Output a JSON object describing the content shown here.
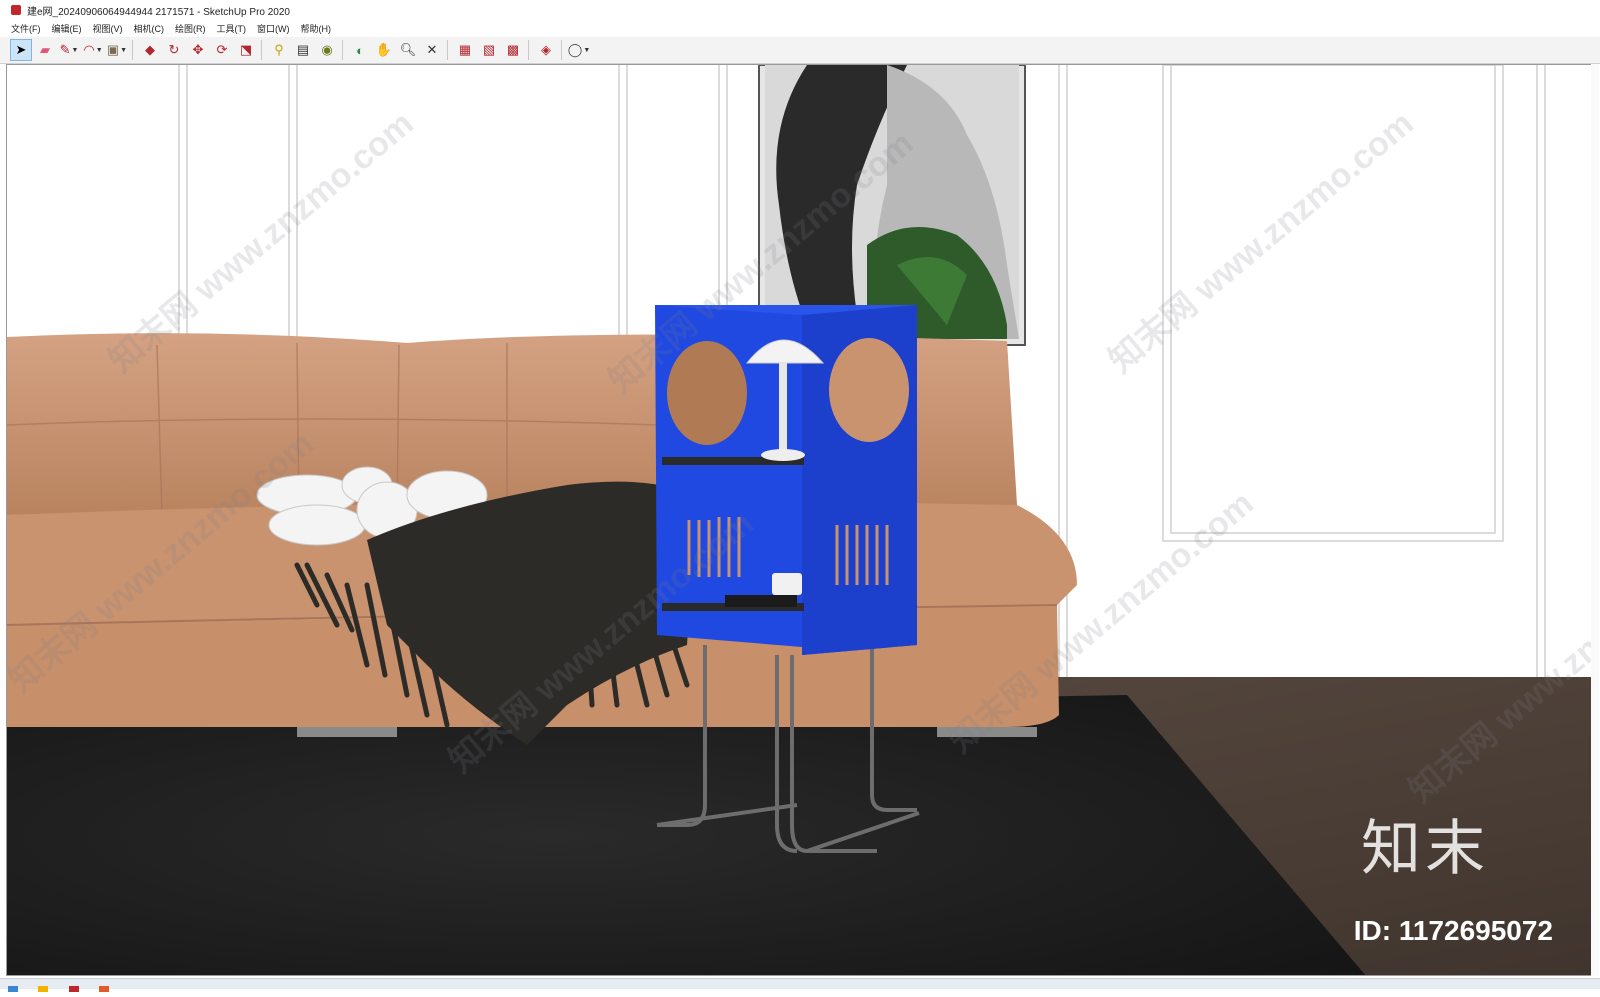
{
  "window": {
    "title": "建e网_20240906064944944 2171571 - SketchUp Pro 2020"
  },
  "menu": {
    "items": [
      "文件(F)",
      "编辑(E)",
      "视图(V)",
      "相机(C)",
      "绘图(R)",
      "工具(T)",
      "窗口(W)",
      "帮助(H)"
    ]
  },
  "toolbar": {
    "tools": [
      "select-icon",
      "eraser-icon",
      "line-icon",
      "arc-icon",
      "rectangle-icon",
      "pushpull-icon",
      "followme-icon",
      "move-icon",
      "rotate-icon",
      "scale-icon",
      "tape-icon",
      "text-icon",
      "paint-icon",
      "orbit-icon",
      "pan-icon",
      "zoom-icon",
      "zoom-extents-icon",
      "warehouse-icon",
      "extension-icon",
      "layout-icon",
      "ruby-icon",
      "account-icon"
    ]
  },
  "watermark": {
    "text": "知末网 www.znzmo.com",
    "logo": "知末",
    "id_label": "ID: 1172695072"
  },
  "colors": {
    "sofa": "#c99370",
    "cabinet": "#1f49e0",
    "rug": "#1d1d1d",
    "floor": "#54463d"
  }
}
